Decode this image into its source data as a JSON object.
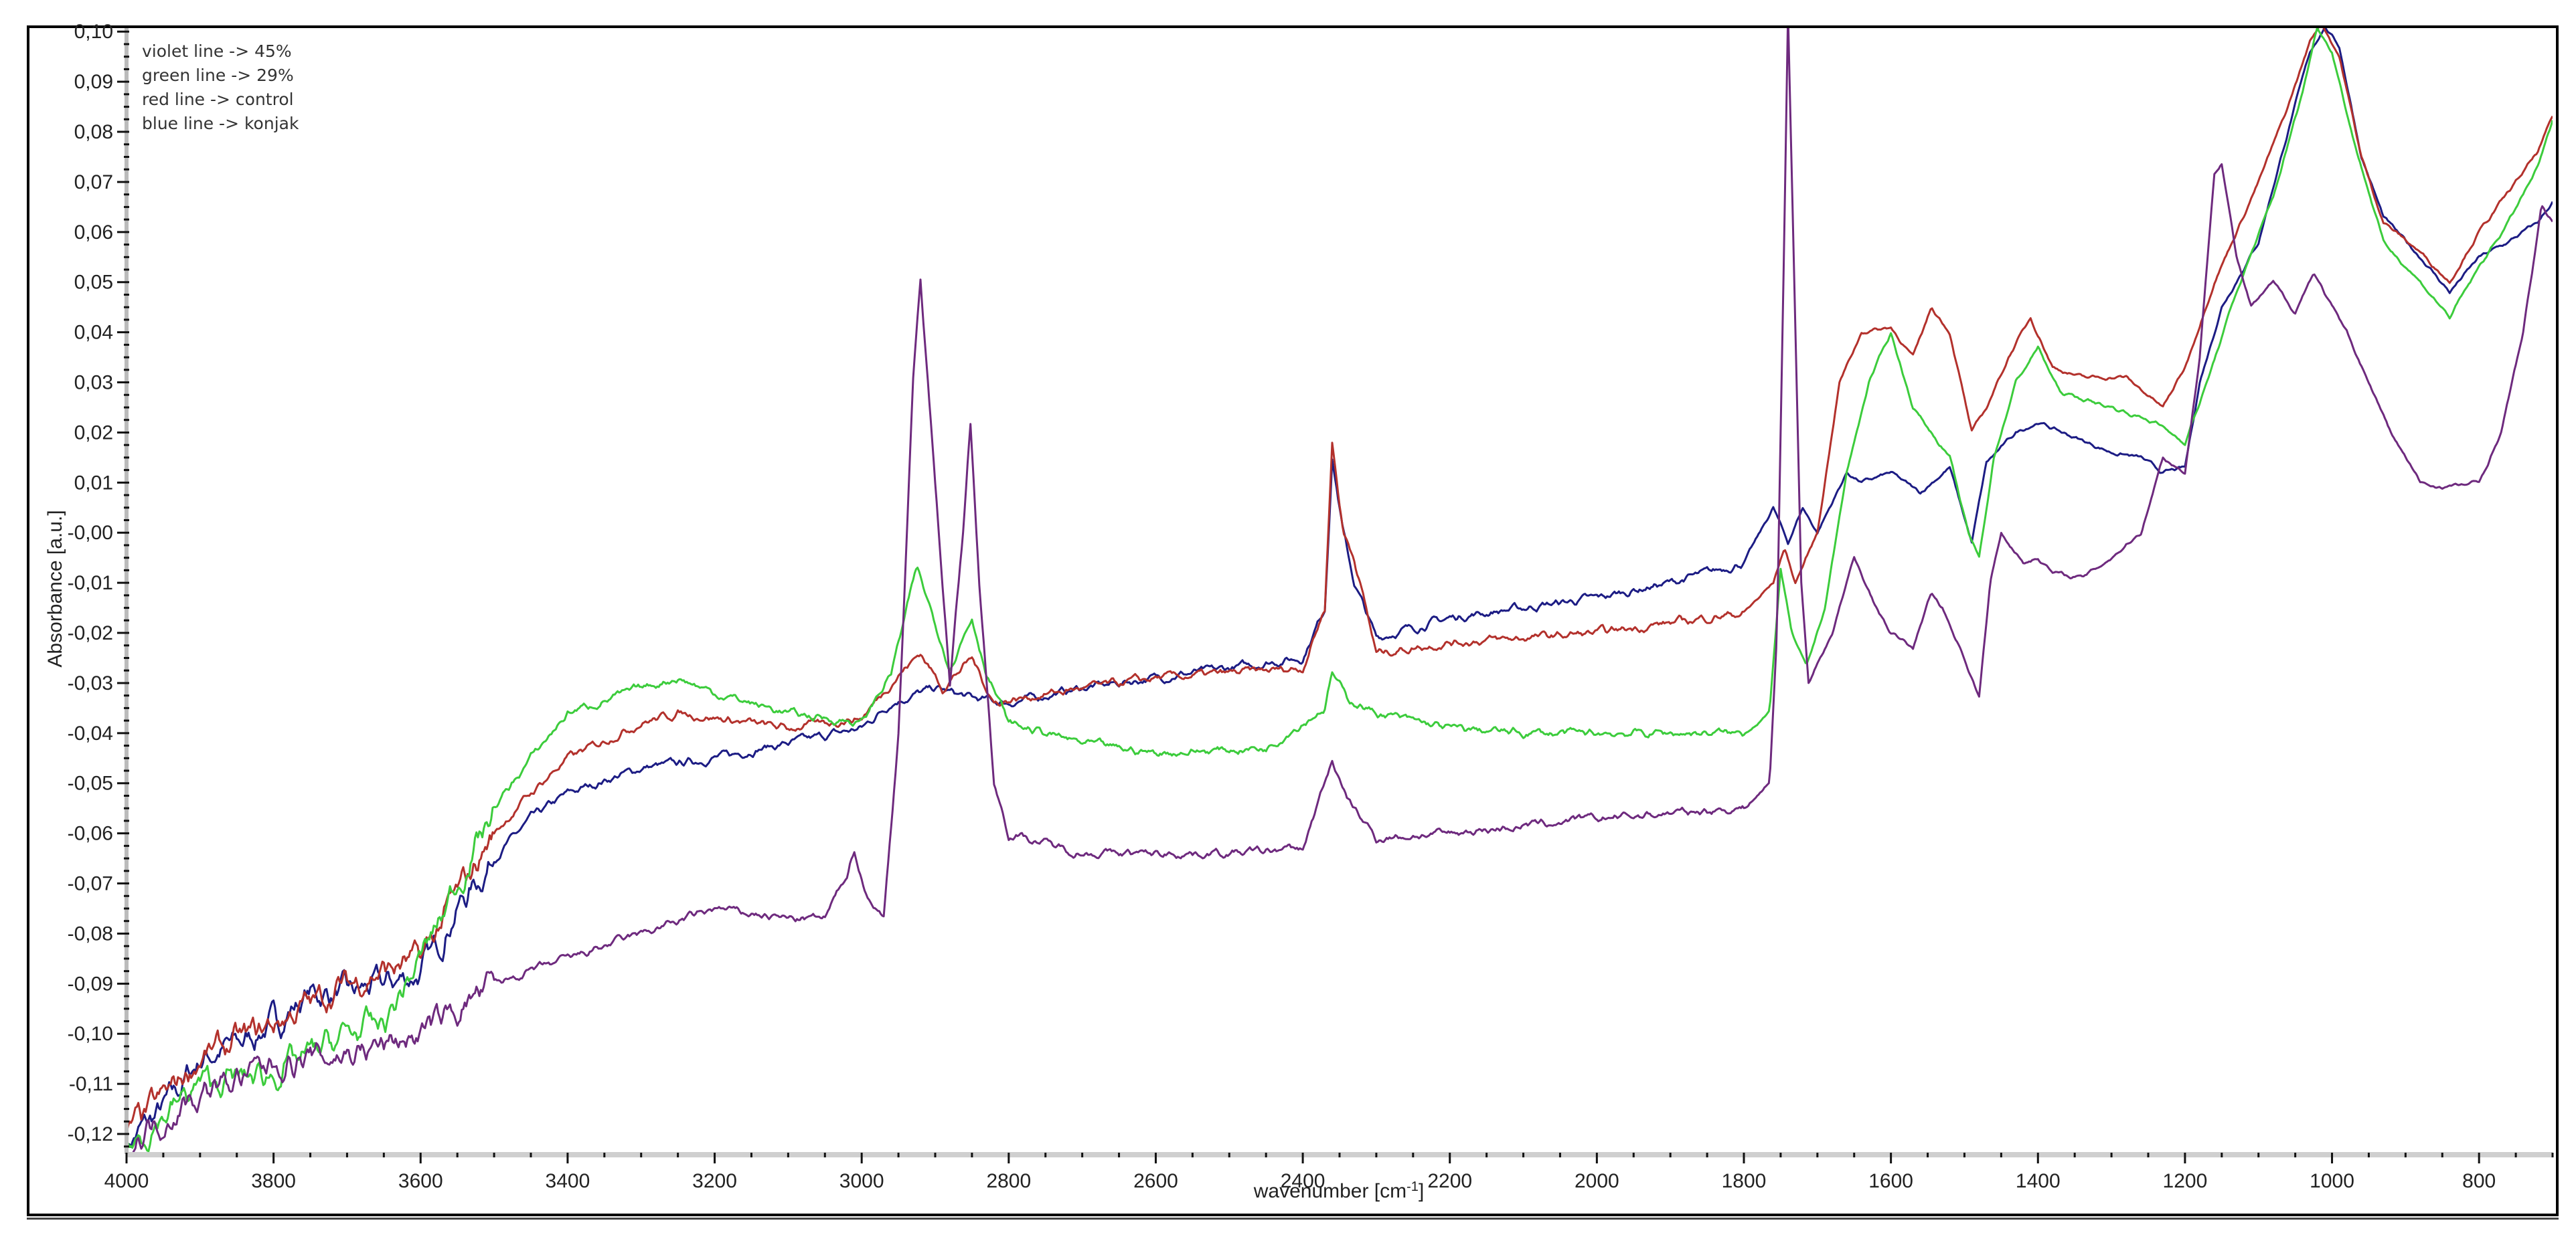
{
  "chart_data": {
    "type": "line",
    "title": "",
    "xlabel": "wavenumber [cm",
    "xlabel_sup": "-1",
    "xlabel_end": "]",
    "ylabel": "Absorbance [a.u.]",
    "xlim": [
      4000,
      700
    ],
    "ylim": [
      -0.124,
      0.1007
    ],
    "grid": false,
    "x_ticks": [
      4000,
      3800,
      3600,
      3400,
      3200,
      3000,
      2800,
      2600,
      2400,
      2200,
      2000,
      1800,
      1600,
      1400,
      1200,
      1000,
      800
    ],
    "x_tick_labels": [
      "4000",
      "3800",
      "3600",
      "3400",
      "3200",
      "3000",
      "2800",
      "2600",
      "2400",
      "2200",
      "2000",
      "1800",
      "1600",
      "1400",
      "1200",
      "1000",
      "800"
    ],
    "y_ticks": [
      0.1,
      0.09,
      0.08,
      0.07,
      0.06,
      0.05,
      0.04,
      0.03,
      0.02,
      0.01,
      0.0,
      -0.01,
      -0.02,
      -0.03,
      -0.04,
      -0.05,
      -0.06,
      -0.07,
      -0.08,
      -0.09,
      -0.1,
      -0.11,
      -0.12
    ],
    "y_tick_labels": [
      "0,10",
      "0,09",
      "0,08",
      "0,07",
      "0,06",
      "0,05",
      "0,04",
      "0,03",
      "0,02",
      "0,01",
      "-0,00",
      "-0,01",
      "-0,02",
      "-0,03",
      "-0,04",
      "-0,05",
      "-0,06",
      "-0,07",
      "-0,08",
      "-0,09",
      "-0,10",
      "-0,11",
      "-0,12"
    ],
    "legend": {
      "placement": "top-left",
      "entries": [
        "violet line -> 45%",
        "green line -> 29%",
        "red line -> control",
        "blue line -> konjak"
      ]
    },
    "series": [
      {
        "name": "konjak",
        "color": "#1c1c84",
        "points": [
          [
            4000,
            -0.122
          ],
          [
            3950,
            -0.115
          ],
          [
            3900,
            -0.105
          ],
          [
            3850,
            -0.102
          ],
          [
            3800,
            -0.098
          ],
          [
            3750,
            -0.092
          ],
          [
            3700,
            -0.092
          ],
          [
            3650,
            -0.09
          ],
          [
            3600,
            -0.088
          ],
          [
            3550,
            -0.075
          ],
          [
            3500,
            -0.065
          ],
          [
            3450,
            -0.057
          ],
          [
            3400,
            -0.052
          ],
          [
            3300,
            -0.047
          ],
          [
            3200,
            -0.045
          ],
          [
            3100,
            -0.042
          ],
          [
            3000,
            -0.039
          ],
          [
            2960,
            -0.034
          ],
          [
            2900,
            -0.031
          ],
          [
            2850,
            -0.033
          ],
          [
            2800,
            -0.034
          ],
          [
            2700,
            -0.031
          ],
          [
            2600,
            -0.029
          ],
          [
            2500,
            -0.027
          ],
          [
            2400,
            -0.025
          ],
          [
            2370,
            -0.015
          ],
          [
            2360,
            0.015
          ],
          [
            2345,
            0.0
          ],
          [
            2330,
            -0.01
          ],
          [
            2300,
            -0.021
          ],
          [
            2200,
            -0.017
          ],
          [
            2000,
            -0.013
          ],
          [
            1900,
            -0.01
          ],
          [
            1800,
            -0.006
          ],
          [
            1760,
            0.005
          ],
          [
            1740,
            -0.002
          ],
          [
            1720,
            0.005
          ],
          [
            1700,
            0.0
          ],
          [
            1660,
            0.012
          ],
          [
            1640,
            0.01
          ],
          [
            1600,
            0.012
          ],
          [
            1560,
            0.008
          ],
          [
            1520,
            0.013
          ],
          [
            1490,
            -0.002
          ],
          [
            1470,
            0.014
          ],
          [
            1430,
            0.02
          ],
          [
            1400,
            0.022
          ],
          [
            1350,
            0.019
          ],
          [
            1300,
            0.016
          ],
          [
            1260,
            0.015
          ],
          [
            1230,
            0.012
          ],
          [
            1200,
            0.013
          ],
          [
            1180,
            0.03
          ],
          [
            1150,
            0.045
          ],
          [
            1100,
            0.058
          ],
          [
            1060,
            0.08
          ],
          [
            1030,
            0.096
          ],
          [
            1010,
            0.101
          ],
          [
            990,
            0.097
          ],
          [
            960,
            0.075
          ],
          [
            930,
            0.063
          ],
          [
            880,
            0.055
          ],
          [
            840,
            0.048
          ],
          [
            800,
            0.055
          ],
          [
            760,
            0.058
          ],
          [
            720,
            0.062
          ],
          [
            700,
            0.066
          ]
        ]
      },
      {
        "name": "control",
        "color": "#b3312c",
        "points": [
          [
            4000,
            -0.12
          ],
          [
            3900,
            -0.105
          ],
          [
            3800,
            -0.098
          ],
          [
            3700,
            -0.09
          ],
          [
            3600,
            -0.085
          ],
          [
            3550,
            -0.072
          ],
          [
            3500,
            -0.06
          ],
          [
            3450,
            -0.052
          ],
          [
            3400,
            -0.045
          ],
          [
            3300,
            -0.038
          ],
          [
            3250,
            -0.036
          ],
          [
            3200,
            -0.037
          ],
          [
            3100,
            -0.039
          ],
          [
            3000,
            -0.037
          ],
          [
            2960,
            -0.03
          ],
          [
            2920,
            -0.024
          ],
          [
            2890,
            -0.031
          ],
          [
            2850,
            -0.025
          ],
          [
            2820,
            -0.034
          ],
          [
            2700,
            -0.031
          ],
          [
            2600,
            -0.029
          ],
          [
            2500,
            -0.028
          ],
          [
            2400,
            -0.027
          ],
          [
            2370,
            -0.015
          ],
          [
            2360,
            0.018
          ],
          [
            2345,
            0.0
          ],
          [
            2330,
            -0.005
          ],
          [
            2300,
            -0.024
          ],
          [
            2200,
            -0.022
          ],
          [
            2000,
            -0.02
          ],
          [
            1800,
            -0.016
          ],
          [
            1760,
            -0.01
          ],
          [
            1745,
            -0.003
          ],
          [
            1730,
            -0.01
          ],
          [
            1700,
            0.0
          ],
          [
            1670,
            0.03
          ],
          [
            1640,
            0.04
          ],
          [
            1600,
            0.041
          ],
          [
            1570,
            0.035
          ],
          [
            1545,
            0.045
          ],
          [
            1520,
            0.04
          ],
          [
            1490,
            0.02
          ],
          [
            1470,
            0.025
          ],
          [
            1440,
            0.035
          ],
          [
            1410,
            0.043
          ],
          [
            1380,
            0.033
          ],
          [
            1340,
            0.031
          ],
          [
            1280,
            0.031
          ],
          [
            1230,
            0.025
          ],
          [
            1200,
            0.033
          ],
          [
            1160,
            0.05
          ],
          [
            1100,
            0.07
          ],
          [
            1060,
            0.085
          ],
          [
            1030,
            0.098
          ],
          [
            1015,
            0.102
          ],
          [
            990,
            0.095
          ],
          [
            960,
            0.075
          ],
          [
            930,
            0.062
          ],
          [
            880,
            0.056
          ],
          [
            840,
            0.05
          ],
          [
            800,
            0.06
          ],
          [
            760,
            0.068
          ],
          [
            720,
            0.076
          ],
          [
            700,
            0.083
          ]
        ]
      },
      {
        "name": "29%",
        "color": "#3ccc3c",
        "points": [
          [
            4000,
            -0.123
          ],
          [
            3900,
            -0.11
          ],
          [
            3800,
            -0.108
          ],
          [
            3700,
            -0.1
          ],
          [
            3650,
            -0.098
          ],
          [
            3600,
            -0.085
          ],
          [
            3550,
            -0.07
          ],
          [
            3500,
            -0.055
          ],
          [
            3450,
            -0.045
          ],
          [
            3400,
            -0.036
          ],
          [
            3300,
            -0.031
          ],
          [
            3250,
            -0.029
          ],
          [
            3200,
            -0.032
          ],
          [
            3100,
            -0.036
          ],
          [
            3000,
            -0.038
          ],
          [
            2960,
            -0.028
          ],
          [
            2925,
            -0.007
          ],
          [
            2900,
            -0.018
          ],
          [
            2880,
            -0.027
          ],
          [
            2850,
            -0.017
          ],
          [
            2830,
            -0.028
          ],
          [
            2800,
            -0.038
          ],
          [
            2700,
            -0.042
          ],
          [
            2600,
            -0.044
          ],
          [
            2450,
            -0.043
          ],
          [
            2370,
            -0.035
          ],
          [
            2360,
            -0.028
          ],
          [
            2340,
            -0.033
          ],
          [
            2300,
            -0.036
          ],
          [
            2200,
            -0.039
          ],
          [
            2100,
            -0.04
          ],
          [
            2000,
            -0.04
          ],
          [
            1800,
            -0.04
          ],
          [
            1765,
            -0.036
          ],
          [
            1750,
            -0.007
          ],
          [
            1735,
            -0.02
          ],
          [
            1715,
            -0.027
          ],
          [
            1690,
            -0.015
          ],
          [
            1660,
            0.012
          ],
          [
            1630,
            0.03
          ],
          [
            1600,
            0.04
          ],
          [
            1570,
            0.025
          ],
          [
            1545,
            0.02
          ],
          [
            1520,
            0.015
          ],
          [
            1495,
            0.0
          ],
          [
            1480,
            -0.005
          ],
          [
            1460,
            0.015
          ],
          [
            1430,
            0.03
          ],
          [
            1400,
            0.037
          ],
          [
            1370,
            0.028
          ],
          [
            1300,
            0.025
          ],
          [
            1240,
            0.022
          ],
          [
            1200,
            0.018
          ],
          [
            1170,
            0.03
          ],
          [
            1130,
            0.048
          ],
          [
            1080,
            0.067
          ],
          [
            1040,
            0.088
          ],
          [
            1020,
            0.101
          ],
          [
            1000,
            0.096
          ],
          [
            970,
            0.078
          ],
          [
            930,
            0.058
          ],
          [
            880,
            0.05
          ],
          [
            840,
            0.043
          ],
          [
            800,
            0.053
          ],
          [
            760,
            0.062
          ],
          [
            720,
            0.073
          ],
          [
            700,
            0.082
          ]
        ]
      },
      {
        "name": "45%",
        "color": "#6e2a7e",
        "points": [
          [
            4000,
            -0.122
          ],
          [
            3900,
            -0.112
          ],
          [
            3800,
            -0.106
          ],
          [
            3700,
            -0.104
          ],
          [
            3600,
            -0.1
          ],
          [
            3500,
            -0.09
          ],
          [
            3400,
            -0.085
          ],
          [
            3300,
            -0.08
          ],
          [
            3200,
            -0.075
          ],
          [
            3100,
            -0.077
          ],
          [
            3050,
            -0.077
          ],
          [
            3020,
            -0.068
          ],
          [
            3010,
            -0.063
          ],
          [
            2995,
            -0.072
          ],
          [
            2970,
            -0.077
          ],
          [
            2950,
            -0.04
          ],
          [
            2930,
            0.03
          ],
          [
            2920,
            0.051
          ],
          [
            2905,
            0.02
          ],
          [
            2880,
            -0.03
          ],
          [
            2862,
            0.0
          ],
          [
            2852,
            0.022
          ],
          [
            2840,
            -0.01
          ],
          [
            2820,
            -0.05
          ],
          [
            2800,
            -0.06
          ],
          [
            2700,
            -0.064
          ],
          [
            2500,
            -0.064
          ],
          [
            2400,
            -0.063
          ],
          [
            2370,
            -0.05
          ],
          [
            2360,
            -0.045
          ],
          [
            2345,
            -0.052
          ],
          [
            2330,
            -0.055
          ],
          [
            2300,
            -0.061
          ],
          [
            2200,
            -0.06
          ],
          [
            2000,
            -0.057
          ],
          [
            1800,
            -0.055
          ],
          [
            1765,
            -0.05
          ],
          [
            1755,
            -0.02
          ],
          [
            1745,
            0.06
          ],
          [
            1740,
            0.104
          ],
          [
            1733,
            0.06
          ],
          [
            1722,
            -0.01
          ],
          [
            1712,
            -0.03
          ],
          [
            1680,
            -0.02
          ],
          [
            1650,
            -0.005
          ],
          [
            1620,
            -0.015
          ],
          [
            1600,
            -0.02
          ],
          [
            1570,
            -0.023
          ],
          [
            1545,
            -0.012
          ],
          [
            1530,
            -0.015
          ],
          [
            1500,
            -0.025
          ],
          [
            1480,
            -0.033
          ],
          [
            1465,
            -0.01
          ],
          [
            1450,
            0.0
          ],
          [
            1420,
            -0.006
          ],
          [
            1400,
            -0.005
          ],
          [
            1380,
            -0.008
          ],
          [
            1340,
            -0.009
          ],
          [
            1300,
            -0.005
          ],
          [
            1260,
            0.0
          ],
          [
            1230,
            0.015
          ],
          [
            1200,
            0.012
          ],
          [
            1180,
            0.035
          ],
          [
            1160,
            0.072
          ],
          [
            1150,
            0.074
          ],
          [
            1130,
            0.055
          ],
          [
            1110,
            0.045
          ],
          [
            1080,
            0.05
          ],
          [
            1050,
            0.044
          ],
          [
            1025,
            0.052
          ],
          [
            1000,
            0.045
          ],
          [
            980,
            0.04
          ],
          [
            920,
            0.02
          ],
          [
            900,
            0.015
          ],
          [
            880,
            0.01
          ],
          [
            850,
            0.009
          ],
          [
            800,
            0.01
          ],
          [
            770,
            0.02
          ],
          [
            740,
            0.04
          ],
          [
            715,
            0.065
          ],
          [
            700,
            0.062
          ]
        ]
      }
    ]
  }
}
